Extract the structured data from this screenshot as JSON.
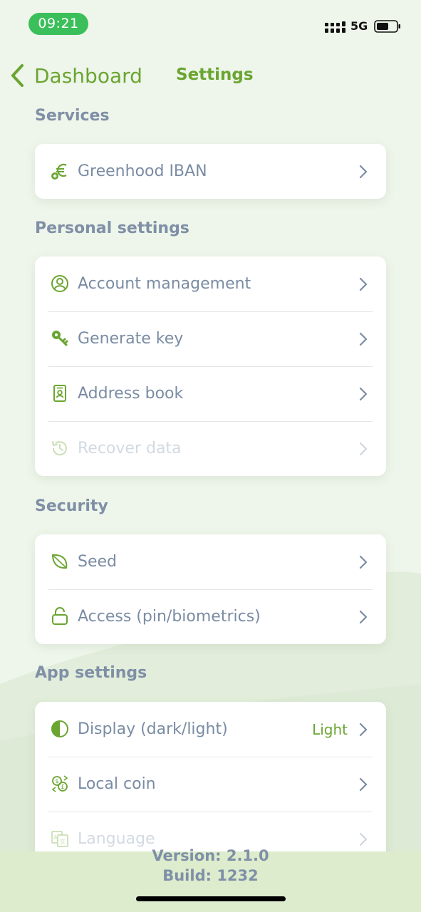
{
  "status_bar": {
    "time": "09:21",
    "network": "5G"
  },
  "nav": {
    "back_label": "Dashboard",
    "title": "Settings"
  },
  "sections": {
    "services": {
      "title": "Services",
      "items": [
        {
          "label": "Greenhood IBAN",
          "icon": "euro-plus-icon"
        }
      ]
    },
    "personal": {
      "title": "Personal settings",
      "items": [
        {
          "label": "Account management",
          "icon": "user-circle-icon"
        },
        {
          "label": "Generate key",
          "icon": "key-icon"
        },
        {
          "label": "Address book",
          "icon": "address-book-icon"
        },
        {
          "label": "Recover data",
          "icon": "history-icon",
          "disabled": true
        }
      ]
    },
    "security": {
      "title": "Security",
      "items": [
        {
          "label": "Seed",
          "icon": "leaf-icon"
        },
        {
          "label": "Access (pin/biometrics)",
          "icon": "lock-icon"
        }
      ]
    },
    "app": {
      "title": "App settings",
      "items": [
        {
          "label": "Display (dark/light)",
          "icon": "contrast-icon",
          "value": "Light"
        },
        {
          "label": "Local coin",
          "icon": "currency-exchange-icon"
        },
        {
          "label": "Language",
          "icon": "translate-icon",
          "disabled": true
        }
      ]
    }
  },
  "footer": {
    "version": "Version: 2.1.0",
    "build": "Build: 1232"
  },
  "colors": {
    "accent": "#6aa531",
    "status_pill": "#3bbf5a",
    "text": "#7a8ca3",
    "section": "#7f8fa6"
  }
}
